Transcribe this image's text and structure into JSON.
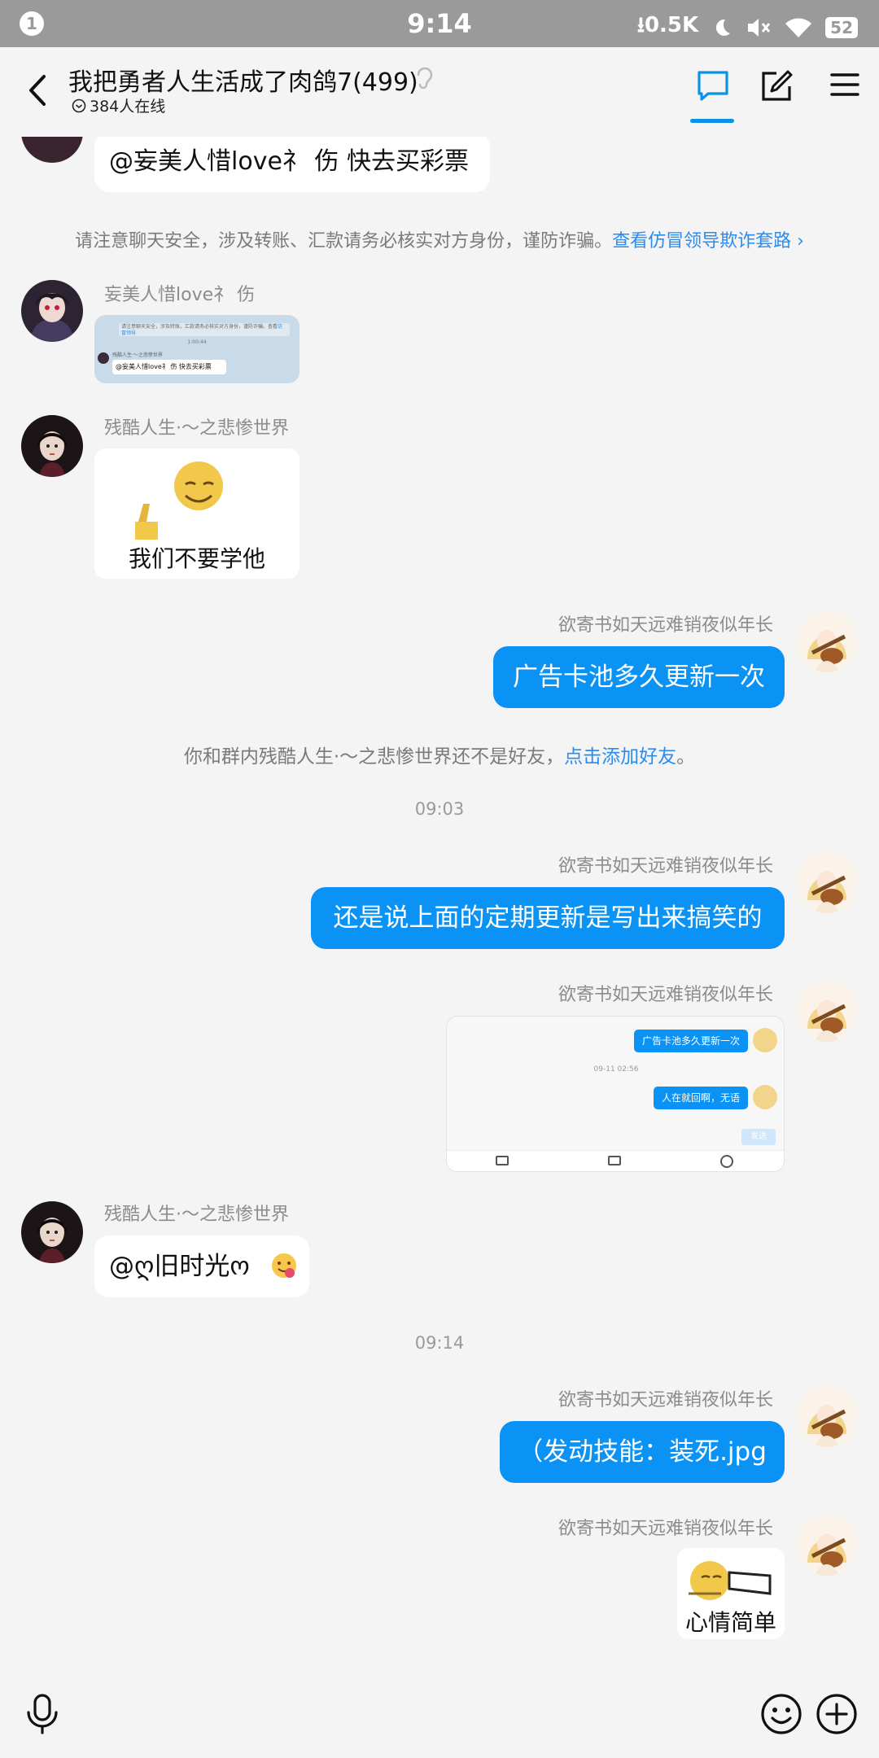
{
  "status_bar": {
    "notification_count": "1",
    "time": "9:14",
    "speed": "0.5K",
    "battery": "52"
  },
  "header": {
    "title": "我把勇者人生活成了肉鸽7(499)",
    "online": "384人在线"
  },
  "messages": {
    "top_bubble": "@妄美人惜love礻 伤 快去买彩票",
    "safety_notice": "请注意聊天安全，涉及转账、汇款请务必核实对方身份，谨防诈骗。",
    "safety_link": "查看仿冒领导欺诈套路",
    "sender_a": "妄美人惜love礻 伤",
    "sender_b": "残酷人生·～之悲惨世界",
    "sender_self": "欲寄书如天远难销夜似年长",
    "sticker_text": "我们不要学他",
    "msg_1": "广告卡池多久更新一次",
    "friend_notice": "你和群内残酷人生·～之悲惨世界还不是好友，",
    "friend_link": "点击添加好友",
    "friend_end": "。",
    "time_1": "09:03",
    "msg_2": "还是说上面的定期更新是写出来搞笑的",
    "shot_msg_1": "广告卡池多久更新一次",
    "shot_time": "09-11 02:56",
    "shot_msg_2": "人在就回啊，无语",
    "shot_send": "发送",
    "msg_3": "@ღ旧时光ო",
    "time_2": "09:14",
    "msg_4": "（发动技能：装死.jpg",
    "sticker_2_text": "心情简单",
    "thumb_notice": "请注意聊天安全，涉及转账，汇款请务必核实对方身份，谨防诈骗。查看",
    "thumb_link": "仿冒领导",
    "thumb_time": "1:00:44",
    "thumb_sender": "残酷人生·～之悲惨世界",
    "thumb_bubble": "@妄美人惜love礻 伤 快去买彩票"
  },
  "colors": {
    "accent": "#0a93f5",
    "link": "#2a8cf0",
    "status_bar": "#9a9a9a"
  }
}
